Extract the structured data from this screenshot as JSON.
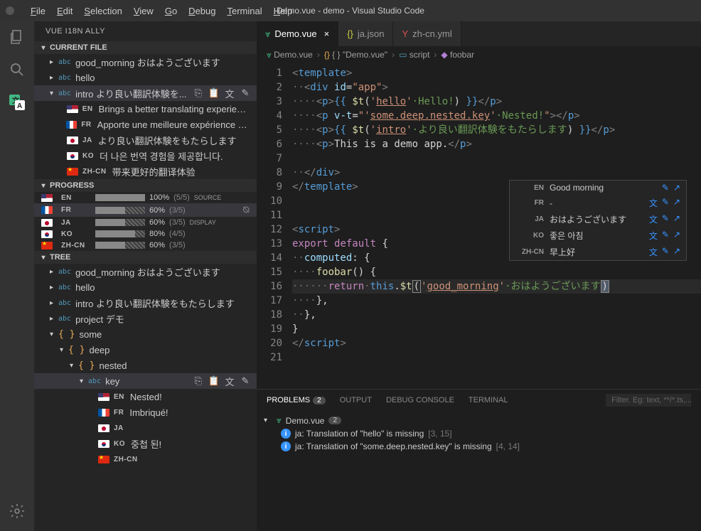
{
  "window": {
    "title": "Demo.vue - demo - Visual Studio Code"
  },
  "menu": [
    "File",
    "Edit",
    "Selection",
    "View",
    "Go",
    "Debug",
    "Terminal",
    "Help"
  ],
  "sidebar_title": "VUE I18N ALLY",
  "sections": {
    "current_file": "CURRENT FILE",
    "progress": "PROGRESS",
    "tree": "TREE"
  },
  "current_file": {
    "items": [
      {
        "key": "good_morning",
        "text": "good_morning おはようございます"
      },
      {
        "key": "hello",
        "text": "hello"
      },
      {
        "key": "intro",
        "text": "intro より良い翻訳体験を...",
        "expanded": true,
        "langs": [
          {
            "code": "EN",
            "flag": "us",
            "text": "Brings a better translating experience"
          },
          {
            "code": "FR",
            "flag": "fr",
            "text": "Apporte une meilleure expérience de..."
          },
          {
            "code": "JA",
            "flag": "jp",
            "text": "より良い翻訳体験をもたらします"
          },
          {
            "code": "KO",
            "flag": "ko",
            "text": "더 나은 번역 경험을 제공합니다."
          },
          {
            "code": "ZH-CN",
            "flag": "cn",
            "text": "带来更好的翻译体验"
          }
        ]
      }
    ]
  },
  "progress": [
    {
      "code": "EN",
      "flag": "us",
      "pct": "100%",
      "count": "(5/5)",
      "tag": "SOURCE",
      "fill": 100
    },
    {
      "code": "FR",
      "flag": "fr",
      "pct": "60%",
      "count": "(3/5)",
      "tag": "",
      "fill": 60,
      "selected": true,
      "eye": true
    },
    {
      "code": "JA",
      "flag": "jp",
      "pct": "60%",
      "count": "(3/5)",
      "tag": "DISPLAY",
      "fill": 60
    },
    {
      "code": "KO",
      "flag": "ko",
      "pct": "80%",
      "count": "(4/5)",
      "tag": "",
      "fill": 80
    },
    {
      "code": "ZH-CN",
      "flag": "cn",
      "pct": "60%",
      "count": "(3/5)",
      "tag": "",
      "fill": 60
    }
  ],
  "tree": [
    {
      "ind": 0,
      "tw": "▸",
      "kind": "abc",
      "label": "good_morning おはようございます"
    },
    {
      "ind": 0,
      "tw": "▸",
      "kind": "abc",
      "label": "hello"
    },
    {
      "ind": 0,
      "tw": "▸",
      "kind": "abc",
      "label": "intro より良い翻訳体験をもたらします"
    },
    {
      "ind": 0,
      "tw": "▸",
      "kind": "abc",
      "label": "project デモ"
    },
    {
      "ind": 0,
      "tw": "▾",
      "kind": "brace",
      "label": "some"
    },
    {
      "ind": 1,
      "tw": "▾",
      "kind": "brace",
      "label": "deep"
    },
    {
      "ind": 2,
      "tw": "▾",
      "kind": "brace",
      "label": "nested"
    },
    {
      "ind": 3,
      "tw": "▾",
      "kind": "abc",
      "label": "key",
      "selected": true,
      "actions": true
    },
    {
      "ind": 4,
      "tw": "",
      "kind": "flag",
      "flag": "us",
      "code": "EN",
      "label": "Nested!"
    },
    {
      "ind": 4,
      "tw": "",
      "kind": "flag",
      "flag": "fr",
      "code": "FR",
      "label": "Imbriqué!"
    },
    {
      "ind": 4,
      "tw": "",
      "kind": "flag",
      "flag": "jp",
      "code": "JA",
      "label": ""
    },
    {
      "ind": 4,
      "tw": "",
      "kind": "flag",
      "flag": "ko",
      "code": "KO",
      "label": "중첩 된!"
    },
    {
      "ind": 4,
      "tw": "",
      "kind": "flag",
      "flag": "cn",
      "code": "ZH-CN",
      "label": ""
    }
  ],
  "tabs": [
    {
      "label": "Demo.vue",
      "icon": "vue",
      "active": true,
      "close": true
    },
    {
      "label": "ja.json",
      "icon": "json"
    },
    {
      "label": "zh-cn.yml",
      "icon": "yml"
    }
  ],
  "breadcrumb": [
    "Demo.vue",
    "{ } \"Demo.vue\"",
    "script",
    "foobar"
  ],
  "line_numbers": [
    "1",
    "2",
    "3",
    "4",
    "5",
    "6",
    "7",
    "8",
    "9",
    "10",
    "11",
    "12",
    "13",
    "14",
    "15",
    "16",
    "17",
    "18",
    "19",
    "20",
    "21"
  ],
  "hints": [
    {
      "code": "EN",
      "text": "Good morning",
      "icons": [
        "pen",
        "arrow"
      ]
    },
    {
      "code": "FR",
      "text": "-",
      "icons": [
        "trans",
        "pen",
        "arrow"
      ]
    },
    {
      "code": "JA",
      "text": "おはようございます",
      "icons": [
        "trans",
        "pen",
        "arrow"
      ]
    },
    {
      "code": "KO",
      "text": "좋은 아침",
      "icons": [
        "trans",
        "pen",
        "arrow"
      ]
    },
    {
      "code": "ZH-CN",
      "text": "早上好",
      "icons": [
        "trans",
        "pen",
        "arrow"
      ]
    }
  ],
  "problems": {
    "tabs": {
      "problems": "PROBLEMS",
      "output": "OUTPUT",
      "debug": "DEBUG CONSOLE",
      "terminal": "TERMINAL"
    },
    "badge": "2",
    "filter_placeholder": "Filter. Eg: text, **/*.ts,...",
    "file": "Demo.vue",
    "file_count": "2",
    "items": [
      {
        "msg": "ja: Translation of \"hello\" is missing",
        "loc": "[3, 15]"
      },
      {
        "msg": "ja: Translation of \"some.deep.nested.key\" is missing",
        "loc": "[4, 14]"
      }
    ]
  }
}
